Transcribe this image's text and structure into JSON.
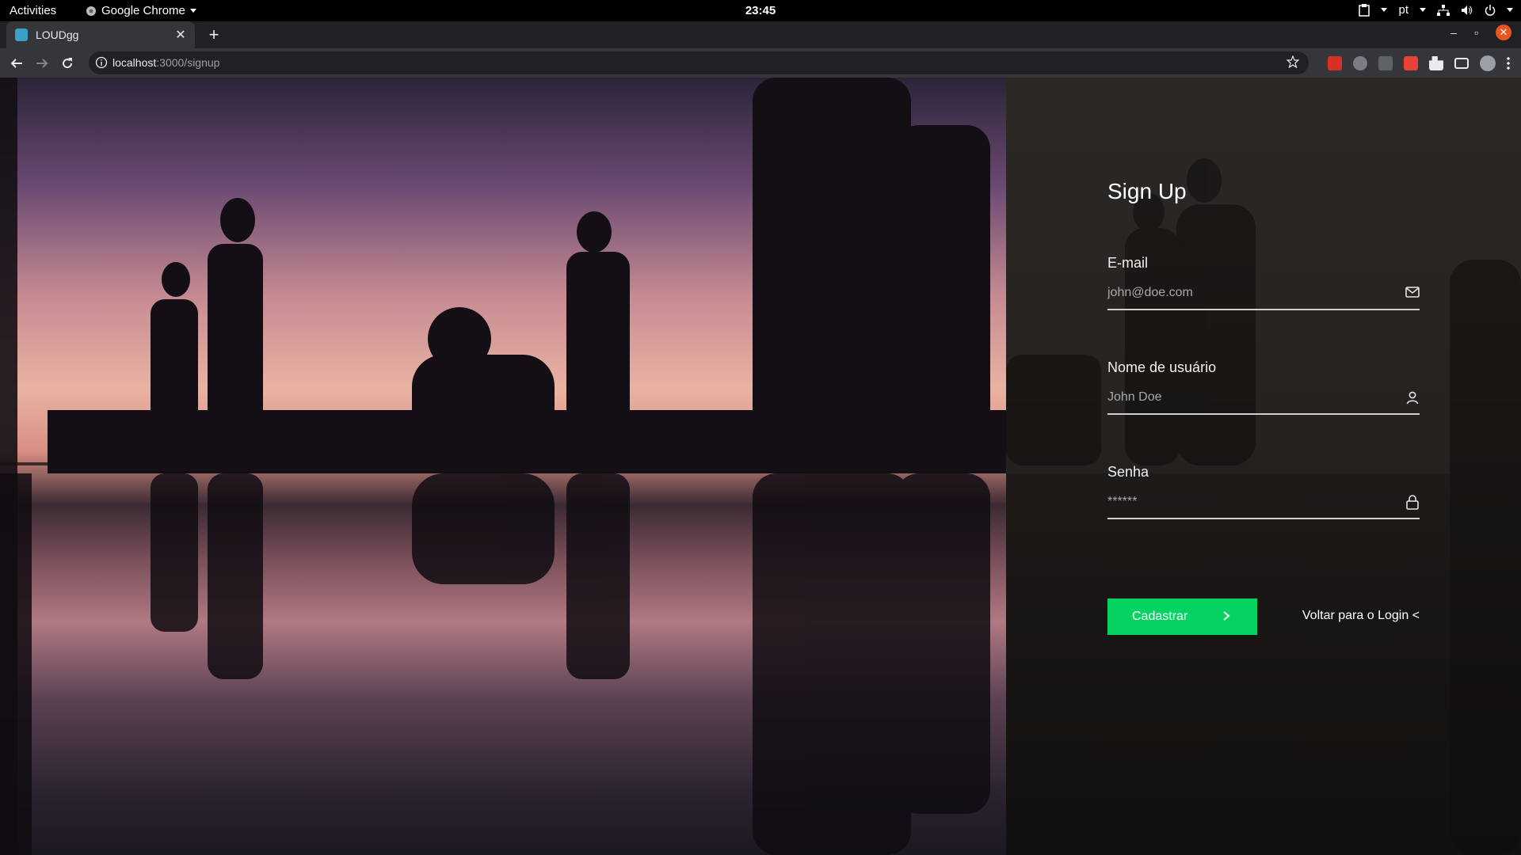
{
  "system_bar": {
    "activities": "Activities",
    "app_name": "Google Chrome",
    "clock": "23:45",
    "language": "pt"
  },
  "browser": {
    "tab_title": "LOUDgg",
    "url_host": "localhost",
    "url_path": ":3000/signup"
  },
  "signup": {
    "title": "Sign Up",
    "email": {
      "label": "E-mail",
      "placeholder": "john@doe.com",
      "icon": "mail-icon"
    },
    "username": {
      "label": "Nome de usuário",
      "placeholder": "John Doe",
      "icon": "user-icon"
    },
    "password": {
      "label": "Senha",
      "placeholder": "******",
      "icon": "lock-icon"
    },
    "submit_label": "Cadastrar",
    "back_link": "Voltar para o Login <"
  },
  "colors": {
    "accent": "#04d361",
    "panel_bg": "#26221f"
  }
}
